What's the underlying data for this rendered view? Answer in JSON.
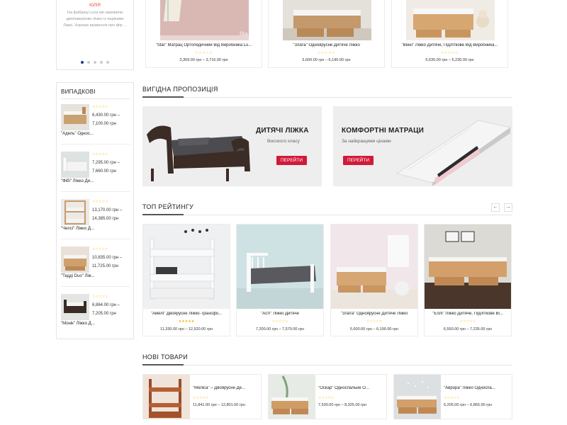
{
  "testimonial": {
    "name": "ЮЛІЯ",
    "text": "На фабриці Luna ми замовили двоповерхове ліжко із ящиками Лаккі. Хороше враження про фір ...",
    "dots": [
      true,
      false,
      false,
      false,
      false
    ]
  },
  "top_products": [
    {
      "title": "\"Star\" Матрац Ортопедичний Від Виробника Lu...",
      "price": "3,359.00 грн – 3,716.00 грн",
      "stars": "☆☆☆☆☆"
    },
    {
      "title": "\"Злата\" Одноярусне Дитяче Ліжко",
      "price": "5,600.00 грн – 6,190.00 грн",
      "stars": "☆☆☆☆☆"
    },
    {
      "title": "\"Вінні\" Ліжко Дитяче, Підліткове Від Виробника...",
      "price": "5,635.00 грн – 6,230.00 грн",
      "stars": "☆☆☆☆☆"
    }
  ],
  "sidebar": {
    "title": "ВИПАДКОВІ",
    "items": [
      {
        "name": "\"Адель\" Однос...",
        "price": "6,430.00 грн – 7,100.00 грн",
        "stars": "☆☆☆☆☆"
      },
      {
        "name": "\"Фібі\" Ліжко Ди...",
        "price": "7,295.00 грн – 7,660.00 грн",
        "stars": "☆☆☆☆☆"
      },
      {
        "name": "\"Челсі\" Ліжко Д...",
        "price": "13,170.00 грн – 14,385.00 грн",
        "stars": "☆☆☆☆☆"
      },
      {
        "name": "\"Тедді Duo\" Ліж...",
        "price": "10,835.00 грн – 11,725.00 грн",
        "stars": "☆☆☆☆☆"
      },
      {
        "name": "\"Монік\" Ліжко Д...",
        "price": "6,864.00 грн – 7,205.00 грн",
        "stars": "☆☆☆☆☆"
      }
    ]
  },
  "offer": {
    "title": "ВИГІДНА ПРОПОЗИЦІЯ",
    "banner1": {
      "heading": "ДИТЯЧІ ЛІЖКА",
      "sub": "Високого класу",
      "button": "ПЕРЕЙТИ"
    },
    "banner2": {
      "heading": "КОМФОРТНІ МАТРАЦИ",
      "sub": "За найкращими цінами",
      "button": "ПЕРЕЙТИ"
    }
  },
  "top_rating": {
    "title": "ТОП РЕЙТИНГУ",
    "prev": "←",
    "next": "→",
    "items": [
      {
        "title": "\"Амелі\" Двоярусне Ліжко-Трансфо...",
        "price": "11,330.00 грн – 12,520.00 грн",
        "stars": "★★★★★",
        "rating": 5
      },
      {
        "title": "\"Асті\" Ліжко Дитяче",
        "price": "7,200.00 грн – 7,570.00 грн",
        "stars": "☆☆☆☆☆",
        "rating": 0
      },
      {
        "title": "\"Злата\" Одноярусне Дитяче Ліжко",
        "price": "5,600.00 грн – 6,190.00 грн",
        "stars": "☆☆☆☆☆",
        "rating": 0
      },
      {
        "title": "\"Еллі\" Ліжко Дитяче, Підліткове Ві...",
        "price": "6,550.00 грн – 7,235.00 грн",
        "stars": "☆☆☆☆☆",
        "rating": 0
      }
    ]
  },
  "new_products": {
    "title": "НОВІ ТОВАРИ",
    "items": [
      {
        "title": "\"Меліса\" – Двоярусне Де...",
        "price": "11,841.00 грн – 12,801.00 грн",
        "stars": "☆☆☆☆☆"
      },
      {
        "title": "\"Оскар\" Односпальне О...",
        "price": "7,530.00 грн – 8,325.00 грн",
        "stars": "☆☆☆☆☆"
      },
      {
        "title": "\"Аврора\" Ліжко Односпа...",
        "price": "6,205.00 грн – 6,865.00 грн",
        "stars": "☆☆☆☆☆"
      }
    ]
  },
  "colors": {
    "accent": "#d11a3a",
    "star": "#f0b400",
    "dot_active": "#1e3a8a",
    "testimonial_name": "#e74c3c"
  }
}
